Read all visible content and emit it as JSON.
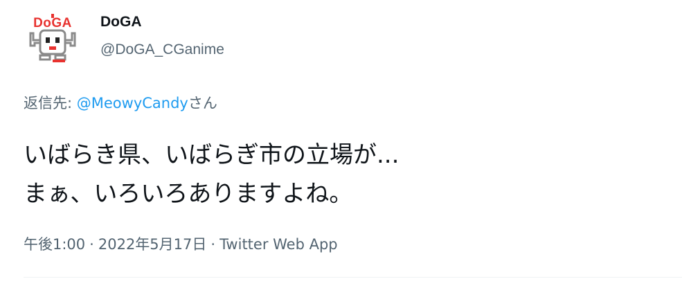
{
  "user": {
    "display_name": "DoGA",
    "handle": "@DoGA_CGanime",
    "avatar_logo_text": "DoGA",
    "avatar_icon": "doga-robot-logo-icon"
  },
  "reply": {
    "prefix": "返信先: ",
    "mention": "@MeowyCandy",
    "suffix": "さん"
  },
  "tweet": {
    "lines": [
      "いばらき県、いばらぎ市の立場が...",
      "まぁ、いろいろありますよね。"
    ]
  },
  "meta": {
    "time": "午後1:00",
    "date": "2022年5月17日",
    "source": "Twitter Web App",
    "separator": "·"
  },
  "colors": {
    "text": "#0f1419",
    "secondary": "#536471",
    "link": "#1d9bf0",
    "logo_red": "#e8322f"
  }
}
